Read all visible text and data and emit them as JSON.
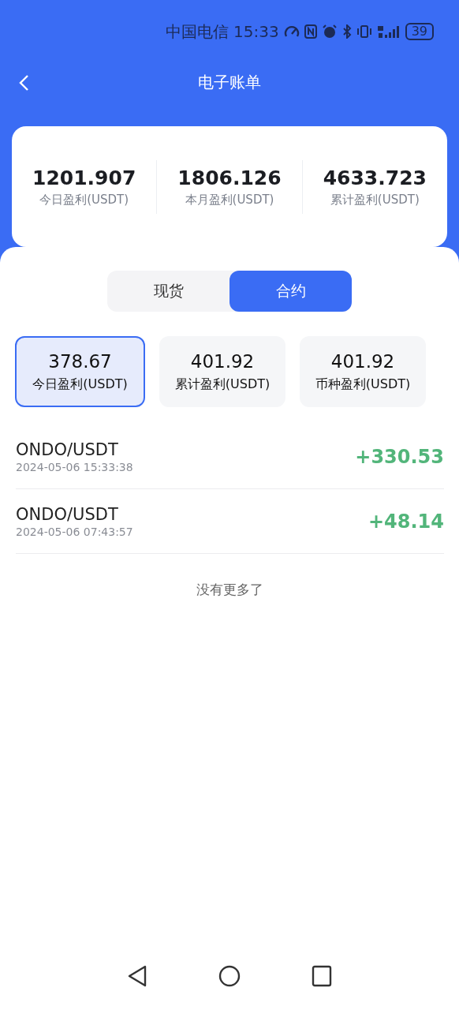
{
  "status_bar": {
    "carrier": "中国电信",
    "time": "15:33",
    "battery": "39"
  },
  "header": {
    "title": "电子账单"
  },
  "summary": [
    {
      "value": "1201.907",
      "label": "今日盈利(USDT)"
    },
    {
      "value": "1806.126",
      "label": "本月盈利(USDT)"
    },
    {
      "value": "4633.723",
      "label": "累计盈利(USDT)"
    }
  ],
  "tabs": [
    {
      "label": "现货",
      "selected": false
    },
    {
      "label": "合约",
      "selected": true
    }
  ],
  "stats": [
    {
      "value": "378.67",
      "label": "今日盈利(USDT)",
      "selected": true
    },
    {
      "value": "401.92",
      "label": "累计盈利(USDT)",
      "selected": false
    },
    {
      "value": "401.92",
      "label": "币种盈利(USDT)",
      "selected": false
    }
  ],
  "records": [
    {
      "pair": "ONDO/USDT",
      "time": "2024-05-06 15:33:38",
      "amount": "+330.53"
    },
    {
      "pair": "ONDO/USDT",
      "time": "2024-05-06 07:43:57",
      "amount": "+48.14"
    }
  ],
  "end_note": "没有更多了"
}
